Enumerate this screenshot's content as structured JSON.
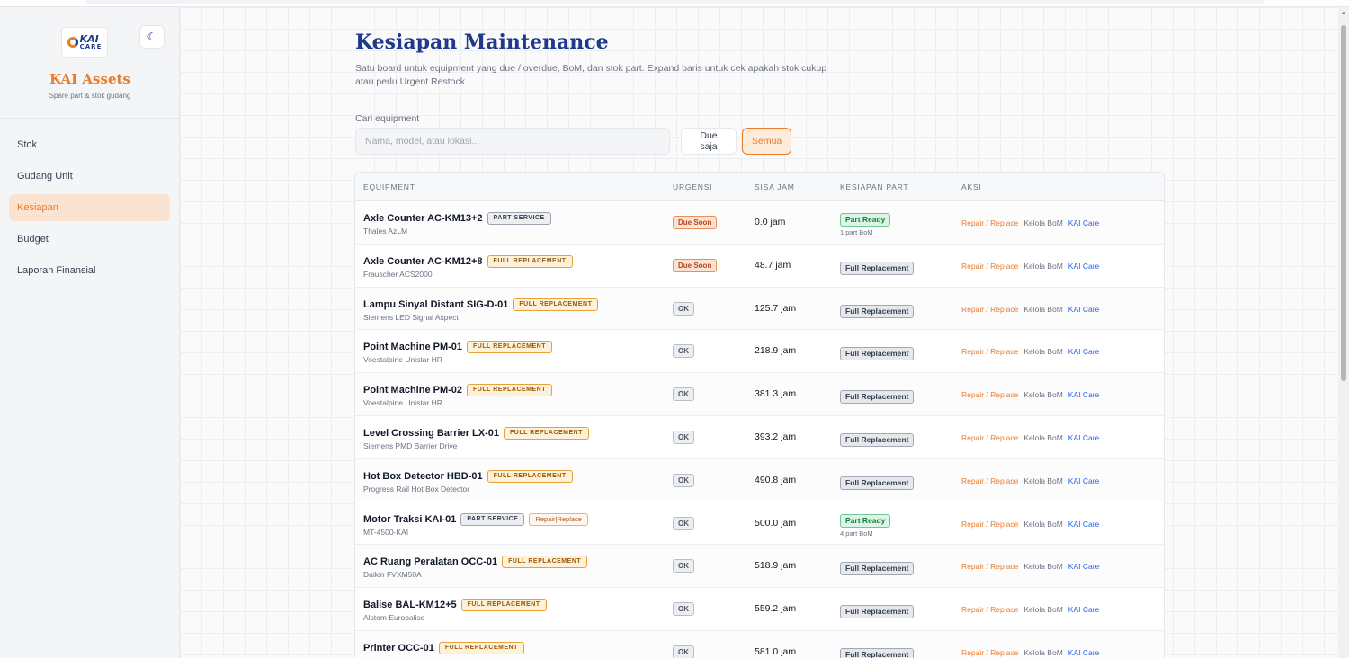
{
  "brand": {
    "logo_top": "KAI",
    "logo_bottom": "CARE",
    "name": "KAI Assets",
    "subtitle": "Spare part & stok gudang",
    "theme_icon": "moon-icon",
    "theme_glyph": "☾"
  },
  "nav": {
    "items": [
      {
        "label": "Stok"
      },
      {
        "label": "Gudang Unit"
      },
      {
        "label": "Kesiapan"
      },
      {
        "label": "Budget"
      },
      {
        "label": "Laporan Finansial"
      }
    ],
    "active_index": 2
  },
  "page": {
    "title": "Kesiapan Maintenance",
    "description": "Satu board untuk equipment yang due / overdue, BoM, dan stok part. Expand baris untuk cek apakah stok cukup atau perlu Urgent Restock."
  },
  "search": {
    "label": "Cari equipment",
    "placeholder": "Nama, model, atau lokasi...",
    "value": ""
  },
  "filters": {
    "due_label": "Due saja",
    "all_label": "Semua",
    "active": "all"
  },
  "table": {
    "headers": {
      "equipment": "EQUIPMENT",
      "urgency": "URGENSI",
      "remaining": "SISA JAM",
      "readiness": "KESIAPAN PART",
      "actions": "AKSI"
    },
    "action_labels": {
      "repair": "Repair / Replace",
      "bom": "Kelola BoM",
      "care": "KAI Care"
    },
    "rows": [
      {
        "name": "Axle Counter AC-KM13+2",
        "tag": "PART SERVICE",
        "tag_type": "service",
        "extra_tag": "",
        "model": "Thales AzLM",
        "urgency": "Due Soon",
        "urgency_type": "due",
        "remaining": "0.0 jam",
        "readiness": "Part Ready",
        "readiness_type": "ready",
        "bom": "1 part BoM"
      },
      {
        "name": "Axle Counter AC-KM12+8",
        "tag": "FULL REPLACEMENT",
        "tag_type": "full",
        "extra_tag": "",
        "model": "Frauscher ACS2000",
        "urgency": "Due Soon",
        "urgency_type": "due",
        "remaining": "48.7 jam",
        "readiness": "Full Replacement",
        "readiness_type": "full",
        "bom": ""
      },
      {
        "name": "Lampu Sinyal Distant SIG-D-01",
        "tag": "FULL REPLACEMENT",
        "tag_type": "full",
        "extra_tag": "",
        "model": "Siemens LED Signal Aspect",
        "urgency": "OK",
        "urgency_type": "ok",
        "remaining": "125.7 jam",
        "readiness": "Full Replacement",
        "readiness_type": "full",
        "bom": ""
      },
      {
        "name": "Point Machine PM-01",
        "tag": "FULL REPLACEMENT",
        "tag_type": "full",
        "extra_tag": "",
        "model": "Voestalpine Unistar HR",
        "urgency": "OK",
        "urgency_type": "ok",
        "remaining": "218.9 jam",
        "readiness": "Full Replacement",
        "readiness_type": "full",
        "bom": ""
      },
      {
        "name": "Point Machine PM-02",
        "tag": "FULL REPLACEMENT",
        "tag_type": "full",
        "extra_tag": "",
        "model": "Voestalpine Unistar HR",
        "urgency": "OK",
        "urgency_type": "ok",
        "remaining": "381.3 jam",
        "readiness": "Full Replacement",
        "readiness_type": "full",
        "bom": ""
      },
      {
        "name": "Level Crossing Barrier LX-01",
        "tag": "FULL REPLACEMENT",
        "tag_type": "full",
        "extra_tag": "",
        "model": "Siemens PMD Barrier Drive",
        "urgency": "OK",
        "urgency_type": "ok",
        "remaining": "393.2 jam",
        "readiness": "Full Replacement",
        "readiness_type": "full",
        "bom": ""
      },
      {
        "name": "Hot Box Detector HBD-01",
        "tag": "FULL REPLACEMENT",
        "tag_type": "full",
        "extra_tag": "",
        "model": "Progress Rail Hot Box Detector",
        "urgency": "OK",
        "urgency_type": "ok",
        "remaining": "490.8 jam",
        "readiness": "Full Replacement",
        "readiness_type": "full",
        "bom": ""
      },
      {
        "name": "Motor Traksi KAI-01",
        "tag": "PART SERVICE",
        "tag_type": "service",
        "extra_tag": "Repair|Replace",
        "model": "MT-4500-KAI",
        "urgency": "OK",
        "urgency_type": "ok",
        "remaining": "500.0 jam",
        "readiness": "Part Ready",
        "readiness_type": "ready",
        "bom": "4 part BoM"
      },
      {
        "name": "AC Ruang Peralatan OCC-01",
        "tag": "FULL REPLACEMENT",
        "tag_type": "full",
        "extra_tag": "",
        "model": "Daikin FVXM50A",
        "urgency": "OK",
        "urgency_type": "ok",
        "remaining": "518.9 jam",
        "readiness": "Full Replacement",
        "readiness_type": "full",
        "bom": ""
      },
      {
        "name": "Balise BAL-KM12+5",
        "tag": "FULL REPLACEMENT",
        "tag_type": "full",
        "extra_tag": "",
        "model": "Alstom Eurobalise",
        "urgency": "OK",
        "urgency_type": "ok",
        "remaining": "559.2 jam",
        "readiness": "Full Replacement",
        "readiness_type": "full",
        "bom": ""
      },
      {
        "name": "Printer OCC-01",
        "tag": "FULL REPLACEMENT",
        "tag_type": "full",
        "extra_tag": "",
        "model": "",
        "urgency": "OK",
        "urgency_type": "ok",
        "remaining": "581.0 jam",
        "readiness": "Full Replacement",
        "readiness_type": "full",
        "bom": ""
      }
    ]
  },
  "colors": {
    "accent": "#ea7c2c",
    "brand_blue": "#1f3a8a",
    "link_blue": "#2563eb"
  }
}
